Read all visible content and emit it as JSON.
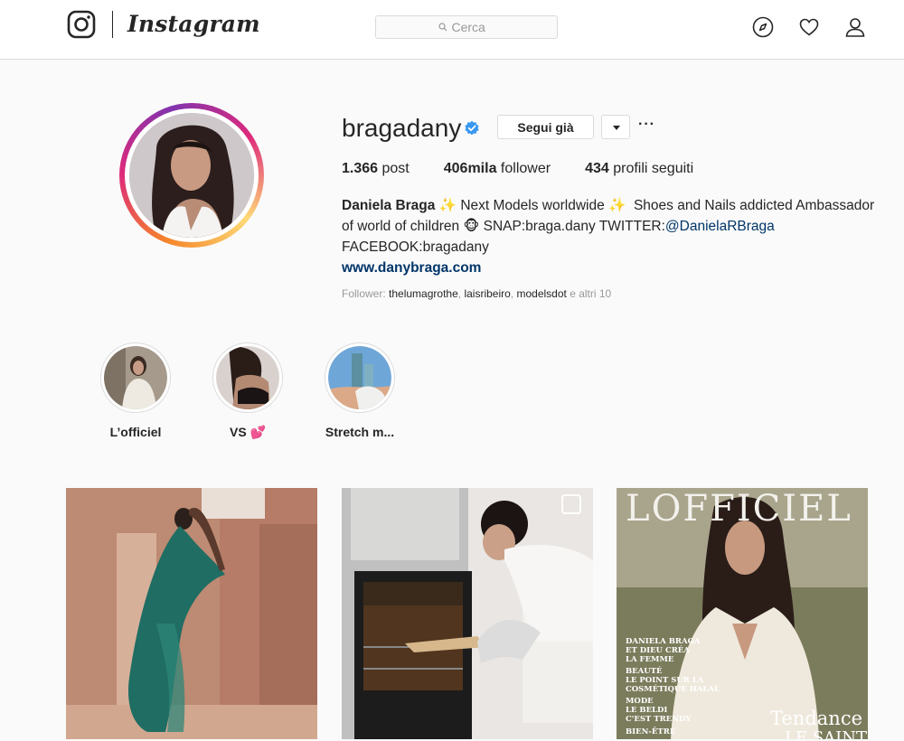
{
  "nav": {
    "wordmark": "Instagram",
    "search_placeholder": "Cerca"
  },
  "profile": {
    "username": "bragadany",
    "follow_label": "Segui già",
    "stats": {
      "posts_count": "1.366",
      "posts_label": "post",
      "followers_count": "406mila",
      "followers_label": "follower",
      "following_count": "434",
      "following_label": "profili seguiti"
    },
    "bio": {
      "name": "Daniela Braga",
      "line1_sparkle1": "✨",
      "line1_text": "Next Models worldwide",
      "line1_sparkle2": "✨",
      "line1_rest": "Shoes and Nails addicted Ambassador",
      "line2_text": "of world of children",
      "line2_emoji": "🐵",
      "line2_rest": "SNAP:braga.dany TWITTER:",
      "twitter_mention": "@DanielaRBraga",
      "line3": "FACEBOOK:bragadany",
      "website": "www.danybraga.com"
    },
    "followed_by": {
      "prefix": "Follower:",
      "account1": "thelumagrothe",
      "sep1": ",",
      "account2": "laisribeiro",
      "sep2": ",",
      "account3": "modelsdot",
      "suffix": "e altri 10"
    }
  },
  "highlights": [
    {
      "label": "L’officiel"
    },
    {
      "label": "VS 💕"
    },
    {
      "label": "Stretch m..."
    }
  ],
  "posts": [
    {
      "alt": "woman in green dress against pink wall"
    },
    {
      "alt": "woman taking tray out of oven"
    },
    {
      "alt": "L'Officiel magazine cover",
      "cover_title": "LOFFICIEL",
      "cover_name": "DANIELA BRAGA",
      "cover_tag1": "ET DIEU CRÉA",
      "cover_tag2": "LA FEMME",
      "cover_tag3": "BEAUTÉ",
      "cover_tag4": "LE POINT SUR LA",
      "cover_tag5": "COSMÉTIQUE HALAL",
      "cover_tag6": "MODE",
      "cover_tag7": "LE BELDI",
      "cover_tag8": "C'EST TRENDY",
      "cover_tag9": "BIEN-ÊTRE",
      "cover_big": "Tendance",
      "cover_big2": "LE SAINT"
    }
  ],
  "colors": {
    "accent_link": "#003569",
    "verified": "#3897f0",
    "border": "#dbdbdb"
  }
}
